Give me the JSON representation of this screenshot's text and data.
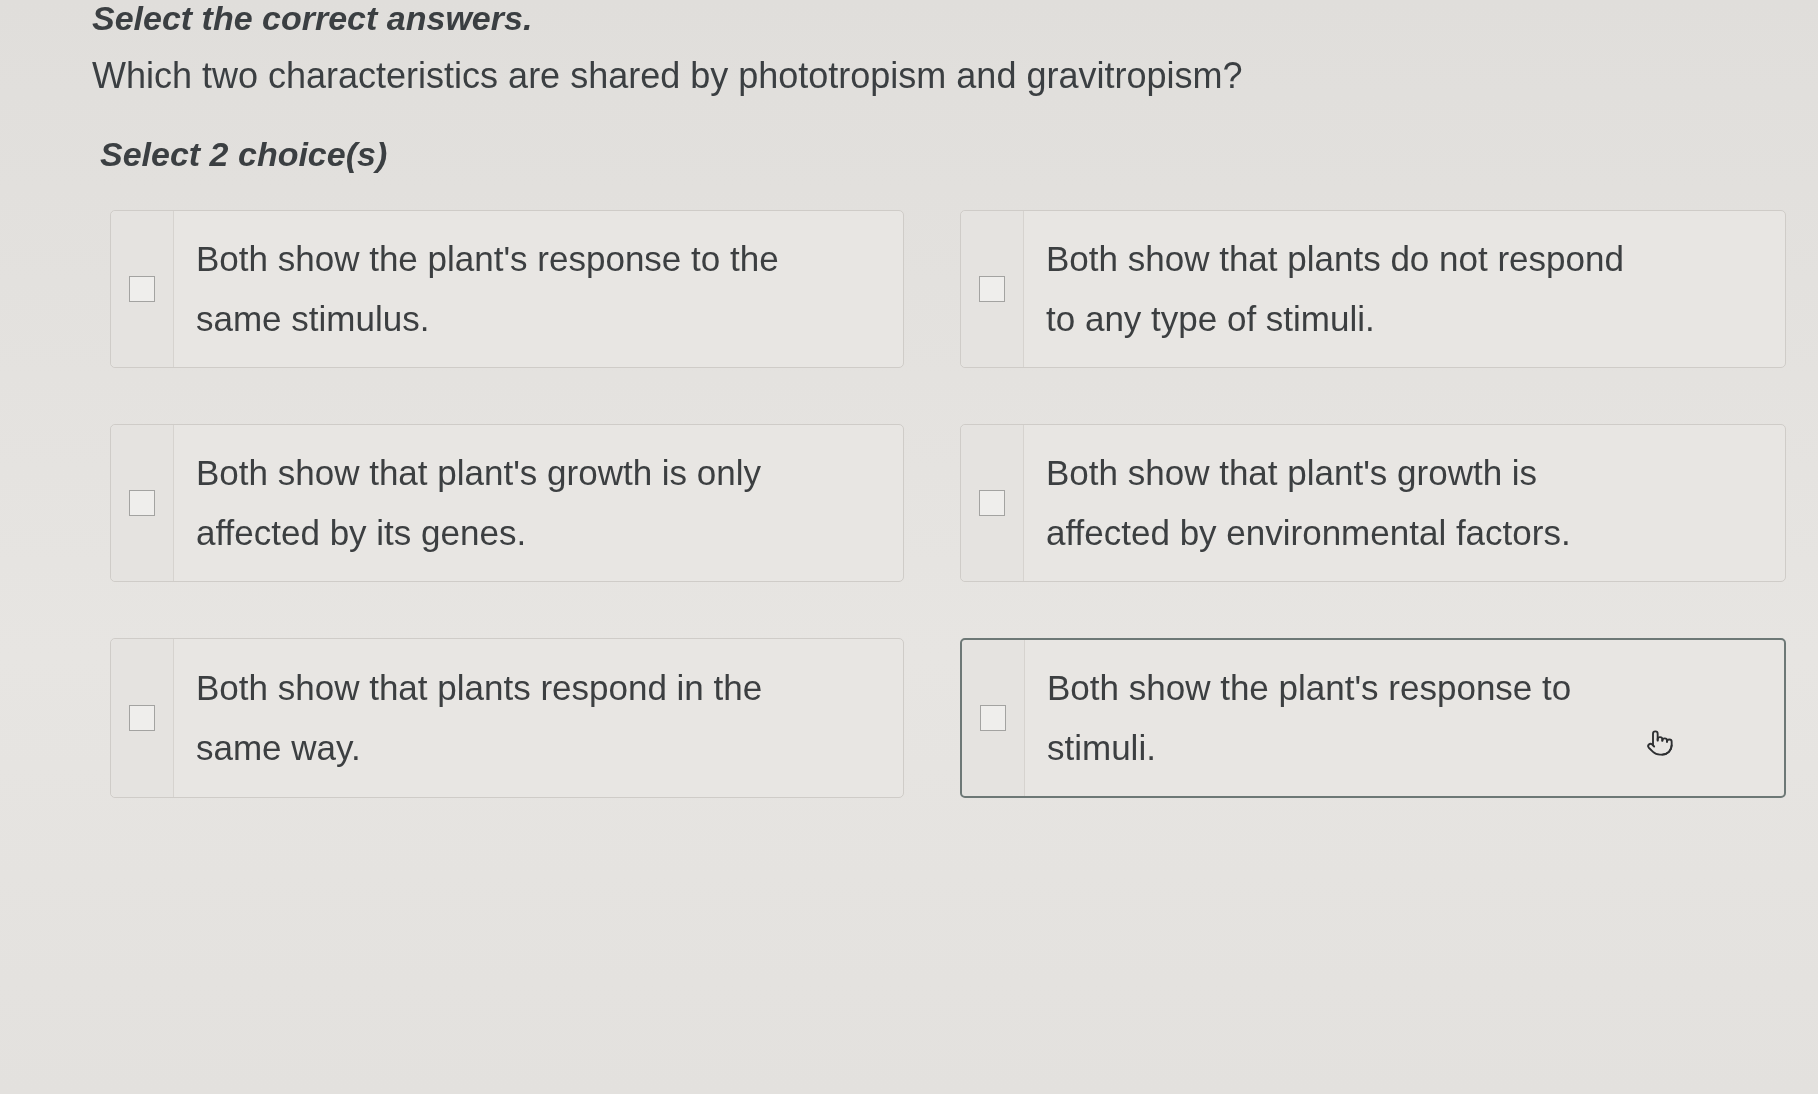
{
  "instruction": "Select the correct answers.",
  "question": "Which two characteristics are shared by phototropism and gravitropism?",
  "choice_hint": "Select 2 choice(s)",
  "choices": [
    {
      "text": "Both show the plant's response to the same stimulus.",
      "checked": false,
      "hovered": false
    },
    {
      "text": "Both show that plants do not respond to any type of stimuli.",
      "checked": false,
      "hovered": false
    },
    {
      "text": "Both show that plant's growth is only affected by its genes.",
      "checked": false,
      "hovered": false
    },
    {
      "text": "Both show that plant's growth is affected by environmental factors.",
      "checked": false,
      "hovered": false
    },
    {
      "text": "Both show that plants respond in the same way.",
      "checked": false,
      "hovered": false
    },
    {
      "text": "Both show the plant's response to stimuli.",
      "checked": false,
      "hovered": true
    }
  ]
}
